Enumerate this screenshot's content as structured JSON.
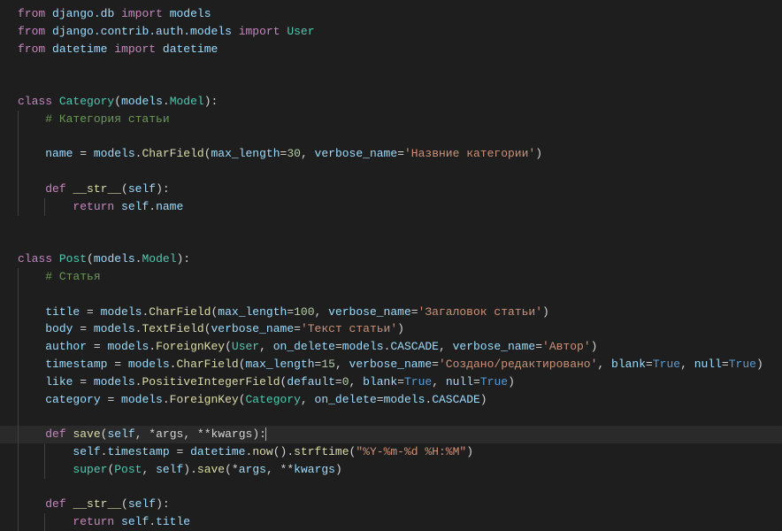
{
  "code": {
    "l1_from": "from",
    "l1_mod": "django.db",
    "l1_import": "import",
    "l1_models": "models",
    "l2_mod": "django.contrib.auth.models",
    "l2_user": "User",
    "l3_mod": "datetime",
    "l3_dt": "datetime",
    "kw_class": "class",
    "kw_def": "def",
    "kw_return": "return",
    "category": "Category",
    "post": "Post",
    "models_model": "models",
    "dot": ".",
    "model": "Model",
    "lp": "(",
    "rp": ")",
    "colon": ":",
    "cmt_cat": "# Категория статьи",
    "cmt_post": "# Статья",
    "name": "name",
    "eq": " = ",
    "charfield": "CharField",
    "textfield": "TextField",
    "foreignkey": "ForeignKey",
    "posint": "PositiveIntegerField",
    "max_length": "max_length",
    "verbose_name": "verbose_name",
    "on_delete": "on_delete",
    "cascade": "CASCADE",
    "default": "default",
    "blank": "blank",
    "null": "null",
    "true": "True",
    "n30": "30",
    "n100": "100",
    "n15": "15",
    "n0": "0",
    "s_cat_name": "'Назвние категории'",
    "s_title": "'Загаловок статьи'",
    "s_body": "'Текст статьи'",
    "s_author": "'Автор'",
    "s_ts": "'Создано/редактировано'",
    "s_fmt": "\"%Y-%m-%d %H:%M\"",
    "dunder_str": "__str__",
    "self": "self",
    "title": "title",
    "body": "body",
    "author": "author",
    "timestamp": "timestamp",
    "like": "like",
    "category_f": "category",
    "save": "save",
    "args": "*args",
    "kwargs": "**kwargs",
    "now": "now",
    "strftime": "strftime",
    "super": "super",
    "comma": ", ",
    "user": "User"
  }
}
